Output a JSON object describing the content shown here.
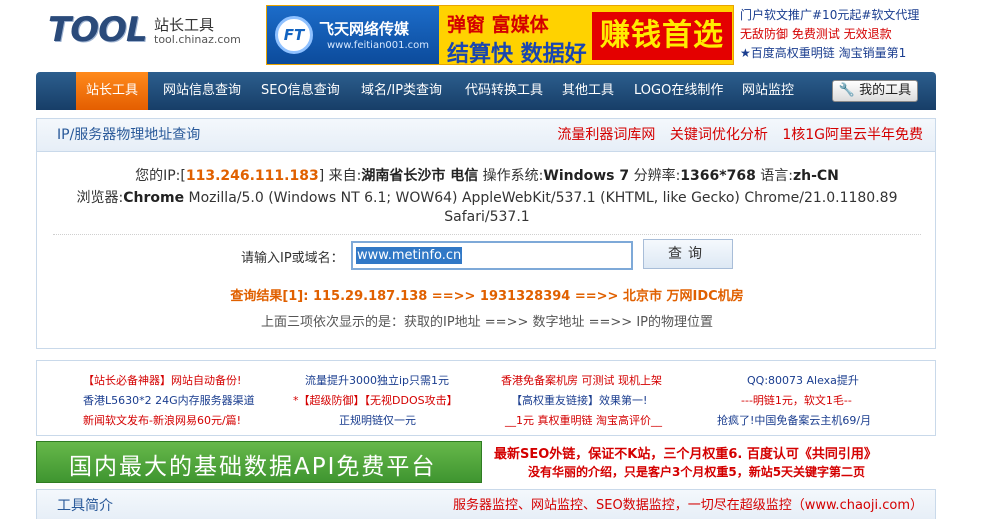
{
  "header": {
    "logo_main": "TOOL",
    "logo_cn": "站长工具",
    "logo_url": "tool.chinaz.com",
    "banner": {
      "ft": "FT",
      "company": "飞天网络传媒",
      "url": "www.feitian001.com",
      "line1": "弹窗 富媒体",
      "line2": "结算快 数据好",
      "right": "赚钱首选"
    },
    "ads": [
      {
        "text": "门户软文推广#10元起#软文代理",
        "color": "blue"
      },
      {
        "text": "无敌防御 免费测试 无效退款",
        "color": "red"
      },
      {
        "text": "★百度高权重明链 淘宝销量第1",
        "color": "blue"
      }
    ]
  },
  "nav": {
    "items": [
      "站长工具",
      "网站信息查询",
      "SEO信息查询",
      "域名/IP类查询",
      "代码转换工具",
      "其他工具",
      "LOGO在线制作",
      "网站监控"
    ],
    "my_tools": "我的工具"
  },
  "panel": {
    "title": "IP/服务器物理地址查询",
    "links": [
      "流量利器词库网",
      "关键词优化分析",
      "1核1G阿里云半年免费"
    ],
    "info": {
      "ip_label": "您的IP:[",
      "ip": "113.246.111.183",
      "from_label": "] 来自:",
      "location": "湖南省长沙市 电信",
      "os_label": " 操作系统:",
      "os": "Windows 7",
      "res_label": " 分辨率:",
      "resolution": "1366*768",
      "lang_label": " 语言:",
      "language": "zh-CN",
      "browser_label": "浏览器:",
      "browser": "Chrome",
      "ua_line1": " Mozilla/5.0 (Windows NT 6.1; WOW64) AppleWebKit/537.1 (KHTML, like Gecko) Chrome/21.0.1180.89",
      "ua_line2": "Safari/537.1"
    },
    "query_label": "请输入IP或域名：",
    "query_value": "www.metinfo.cn",
    "query_button": "查询",
    "result": "查询结果[1]: 115.29.187.138 ==>> 1931328394 ==>> 北京市 万网IDC机房",
    "note": "上面三项依次显示的是：获取的IP地址 ==>> 数字地址 ==>> IP的物理位置"
  },
  "links_block": {
    "rows": [
      [
        {
          "text": "【站长必备神器】网站自动备份!",
          "color": "red"
        },
        {
          "text": "流量提升3000独立ip只需1元",
          "color": "blue"
        },
        {
          "text": "香港免备案机房 可测试 现机上架",
          "color": "red"
        },
        {
          "text": "QQ:80073 Alexa提升",
          "color": "blue"
        }
      ],
      [
        {
          "text": "香港L5630*2 24G内存服务器渠道",
          "color": "blue"
        },
        {
          "text": "*【超级防御】【无视DDOS攻击】",
          "color": "red"
        },
        {
          "text": "【高权重友链接】效果第一!",
          "color": "blue"
        },
        {
          "text": "---明链1元，软文1毛--",
          "color": "red"
        }
      ],
      [
        {
          "text": "新闻软文发布-新浪网易60元/篇!",
          "color": "red"
        },
        {
          "text": "正规明链仅一元",
          "color": "blue"
        },
        {
          "text": "__1元 真权重明链 淘宝高评价__",
          "color": "red"
        },
        {
          "text": "抢疯了!中国免备案云主机69/月",
          "color": "blue"
        }
      ]
    ]
  },
  "bottom": {
    "api_text": "国内最大的基础数据API免费平台",
    "seo_line1": "最新SEO外链，保证不K站，三个月权重6. 百度认可《共同引用》",
    "seo_line2": "没有华丽的介绍，只是客户3个月权重5，新站5天关键字第二页"
  },
  "footer": {
    "title": "工具简介",
    "links": "服务器监控、网站监控、SEO数据监控，一切尽在超级监控（www.chaoji.com）"
  },
  "colors": {
    "nav_bg": "#1f4b78",
    "active": "#f07a12",
    "link_red": "#d40000",
    "link_blue": "#1a3d8f",
    "accent_orange": "#e06000"
  }
}
